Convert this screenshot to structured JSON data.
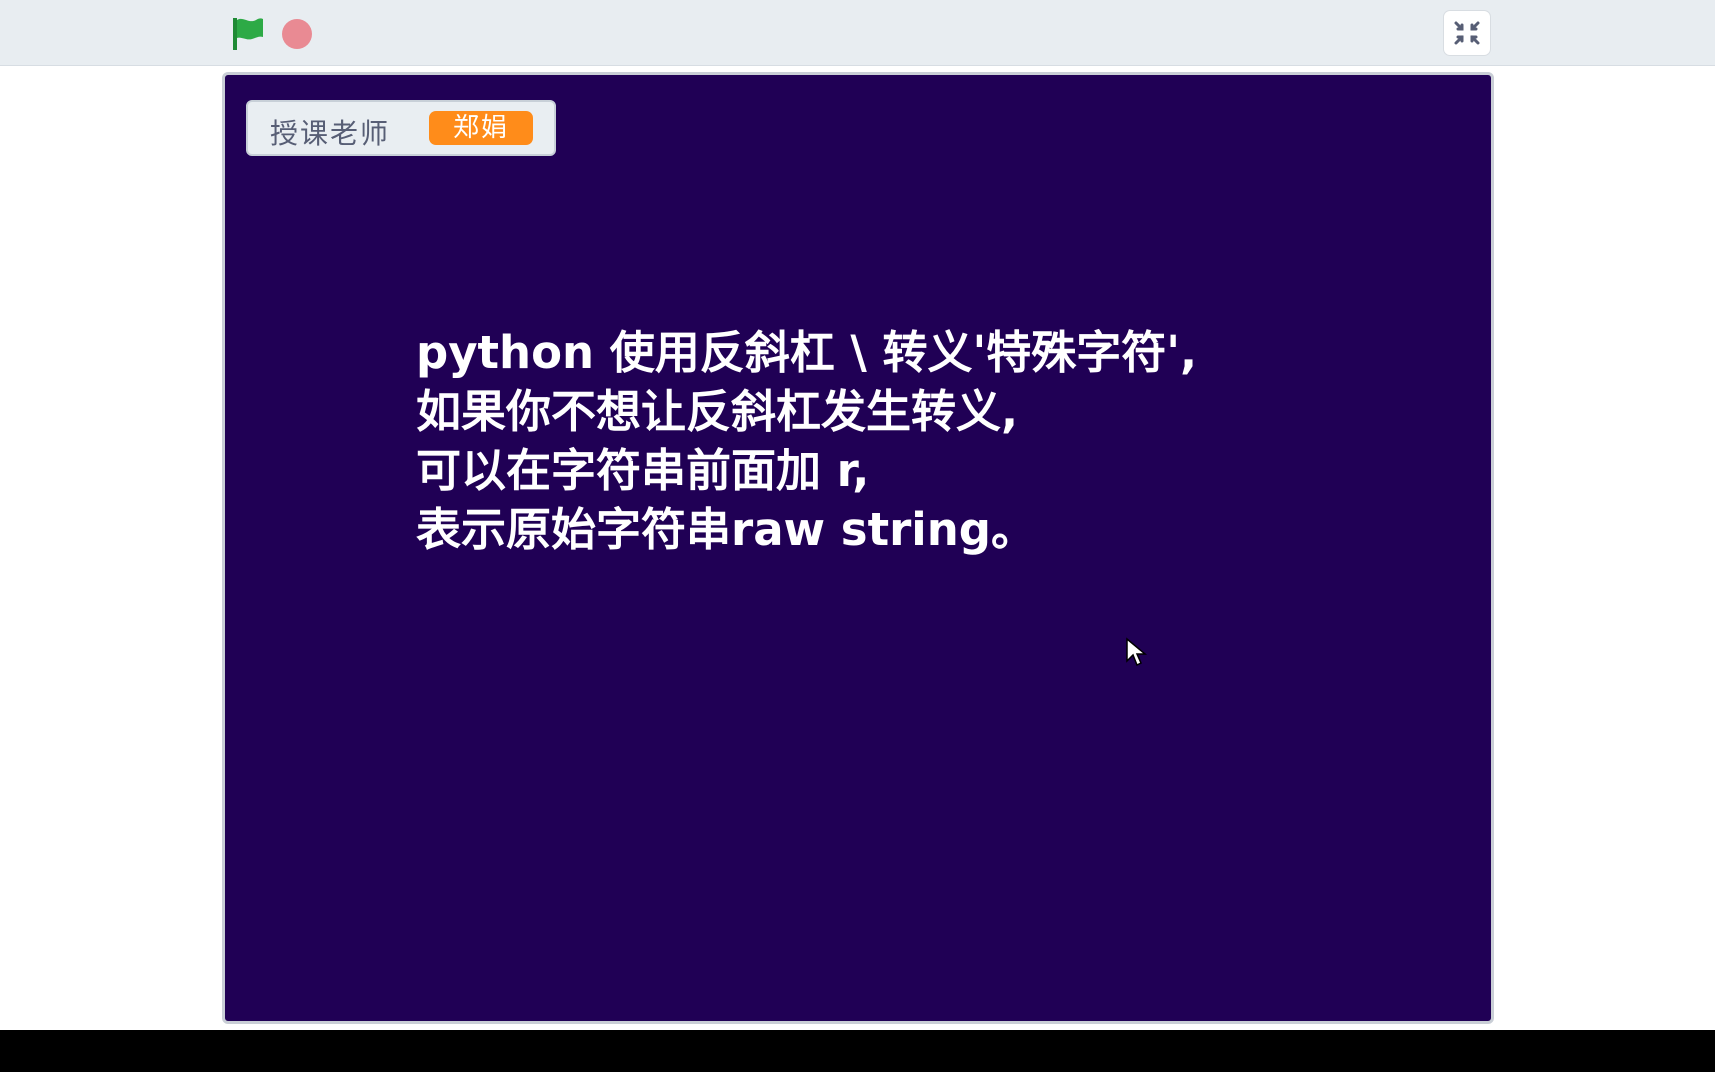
{
  "toolbar": {
    "flag_icon": "green-flag-icon",
    "stop_icon": "stop-icon",
    "fullscreen_icon": "exit-fullscreen-icon",
    "colors": {
      "flag": "#2daa46",
      "stop": "#e98a93",
      "topbar": "#e8edf1"
    }
  },
  "stage": {
    "background": "#200055",
    "monitor": {
      "label": "授课老师",
      "value": "郑娟",
      "value_color": "#ff8c1a"
    },
    "text_lines": [
      "python 使用反斜杠 \\ 转义'特殊字符',",
      "如果你不想让反斜杠发生转义,",
      "可以在字符串前面加 r,",
      "表示原始字符串raw string。"
    ]
  }
}
